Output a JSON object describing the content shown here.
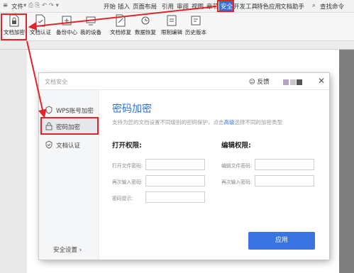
{
  "menubar": {
    "hamburger": "≡",
    "file": "文件",
    "tabs": [
      "开始",
      "插入",
      "页面布局",
      "引用",
      "审阅",
      "视图",
      "章节",
      "安全",
      "开发工具",
      "特色应用",
      "文档助手"
    ],
    "active_tab": "安全",
    "search": "查找命令"
  },
  "ribbon": {
    "buttons": [
      "文档加密",
      "文档认证",
      "备份中心",
      "我的设备",
      "文档修复",
      "数据恢复",
      "限制编辑",
      "历史版本"
    ]
  },
  "dialog": {
    "title": "文档安全",
    "feedback": "反馈",
    "close": "✕",
    "sidebar": {
      "items": [
        "WPS账号加密",
        "密码加密",
        "文档认证"
      ],
      "selected": "密码加密",
      "footer": "安全设置 ›"
    },
    "content": {
      "heading": "密码加密",
      "desc_prefix": "支持为您的文档设置不同级别的密码保护，点击",
      "desc_link": "高级",
      "desc_suffix": "选择不同的加密类型",
      "open_section": "打开权限:",
      "edit_section": "编辑权限:",
      "open_fields": [
        "打开文件密码:",
        "再次输入密码:",
        "密码提示:"
      ],
      "edit_fields": [
        "编辑文件密码:",
        "再次输入密码:"
      ],
      "apply": "应用"
    }
  },
  "colors": {
    "accent": "#2f6fe0",
    "highlight": "#e0242a"
  }
}
